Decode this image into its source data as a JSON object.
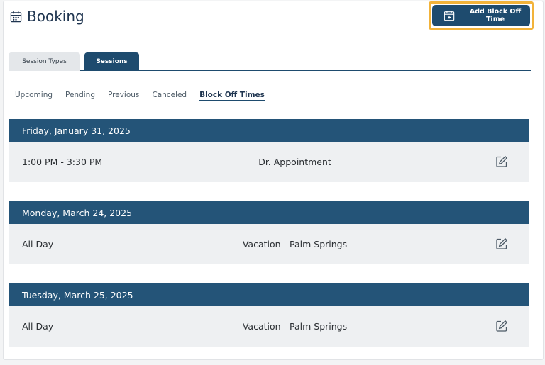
{
  "header": {
    "title": "Booking"
  },
  "cta": {
    "label": "Add Block Off Time",
    "highlight_color": "#f2b33a",
    "color": "#1e4b6e"
  },
  "tabs": [
    {
      "label": "Session Types",
      "active": false
    },
    {
      "label": "Sessions",
      "active": true
    }
  ],
  "subnav": [
    {
      "label": "Upcoming",
      "active": false
    },
    {
      "label": "Pending",
      "active": false
    },
    {
      "label": "Previous",
      "active": false
    },
    {
      "label": "Canceled",
      "active": false
    },
    {
      "label": "Block Off Times",
      "active": true
    }
  ],
  "groups": [
    {
      "date": "Friday, January 31, 2025",
      "time": "1:00 PM - 3:30 PM",
      "description": "Dr. Appointment",
      "icon": "edit-icon"
    },
    {
      "date": "Monday, March 24, 2025",
      "time": "All Day",
      "description": "Vacation - Palm Springs",
      "icon": "edit-icon"
    },
    {
      "date": "Tuesday, March 25, 2025",
      "time": "All Day",
      "description": "Vacation - Palm Springs",
      "icon": "edit-icon"
    }
  ]
}
